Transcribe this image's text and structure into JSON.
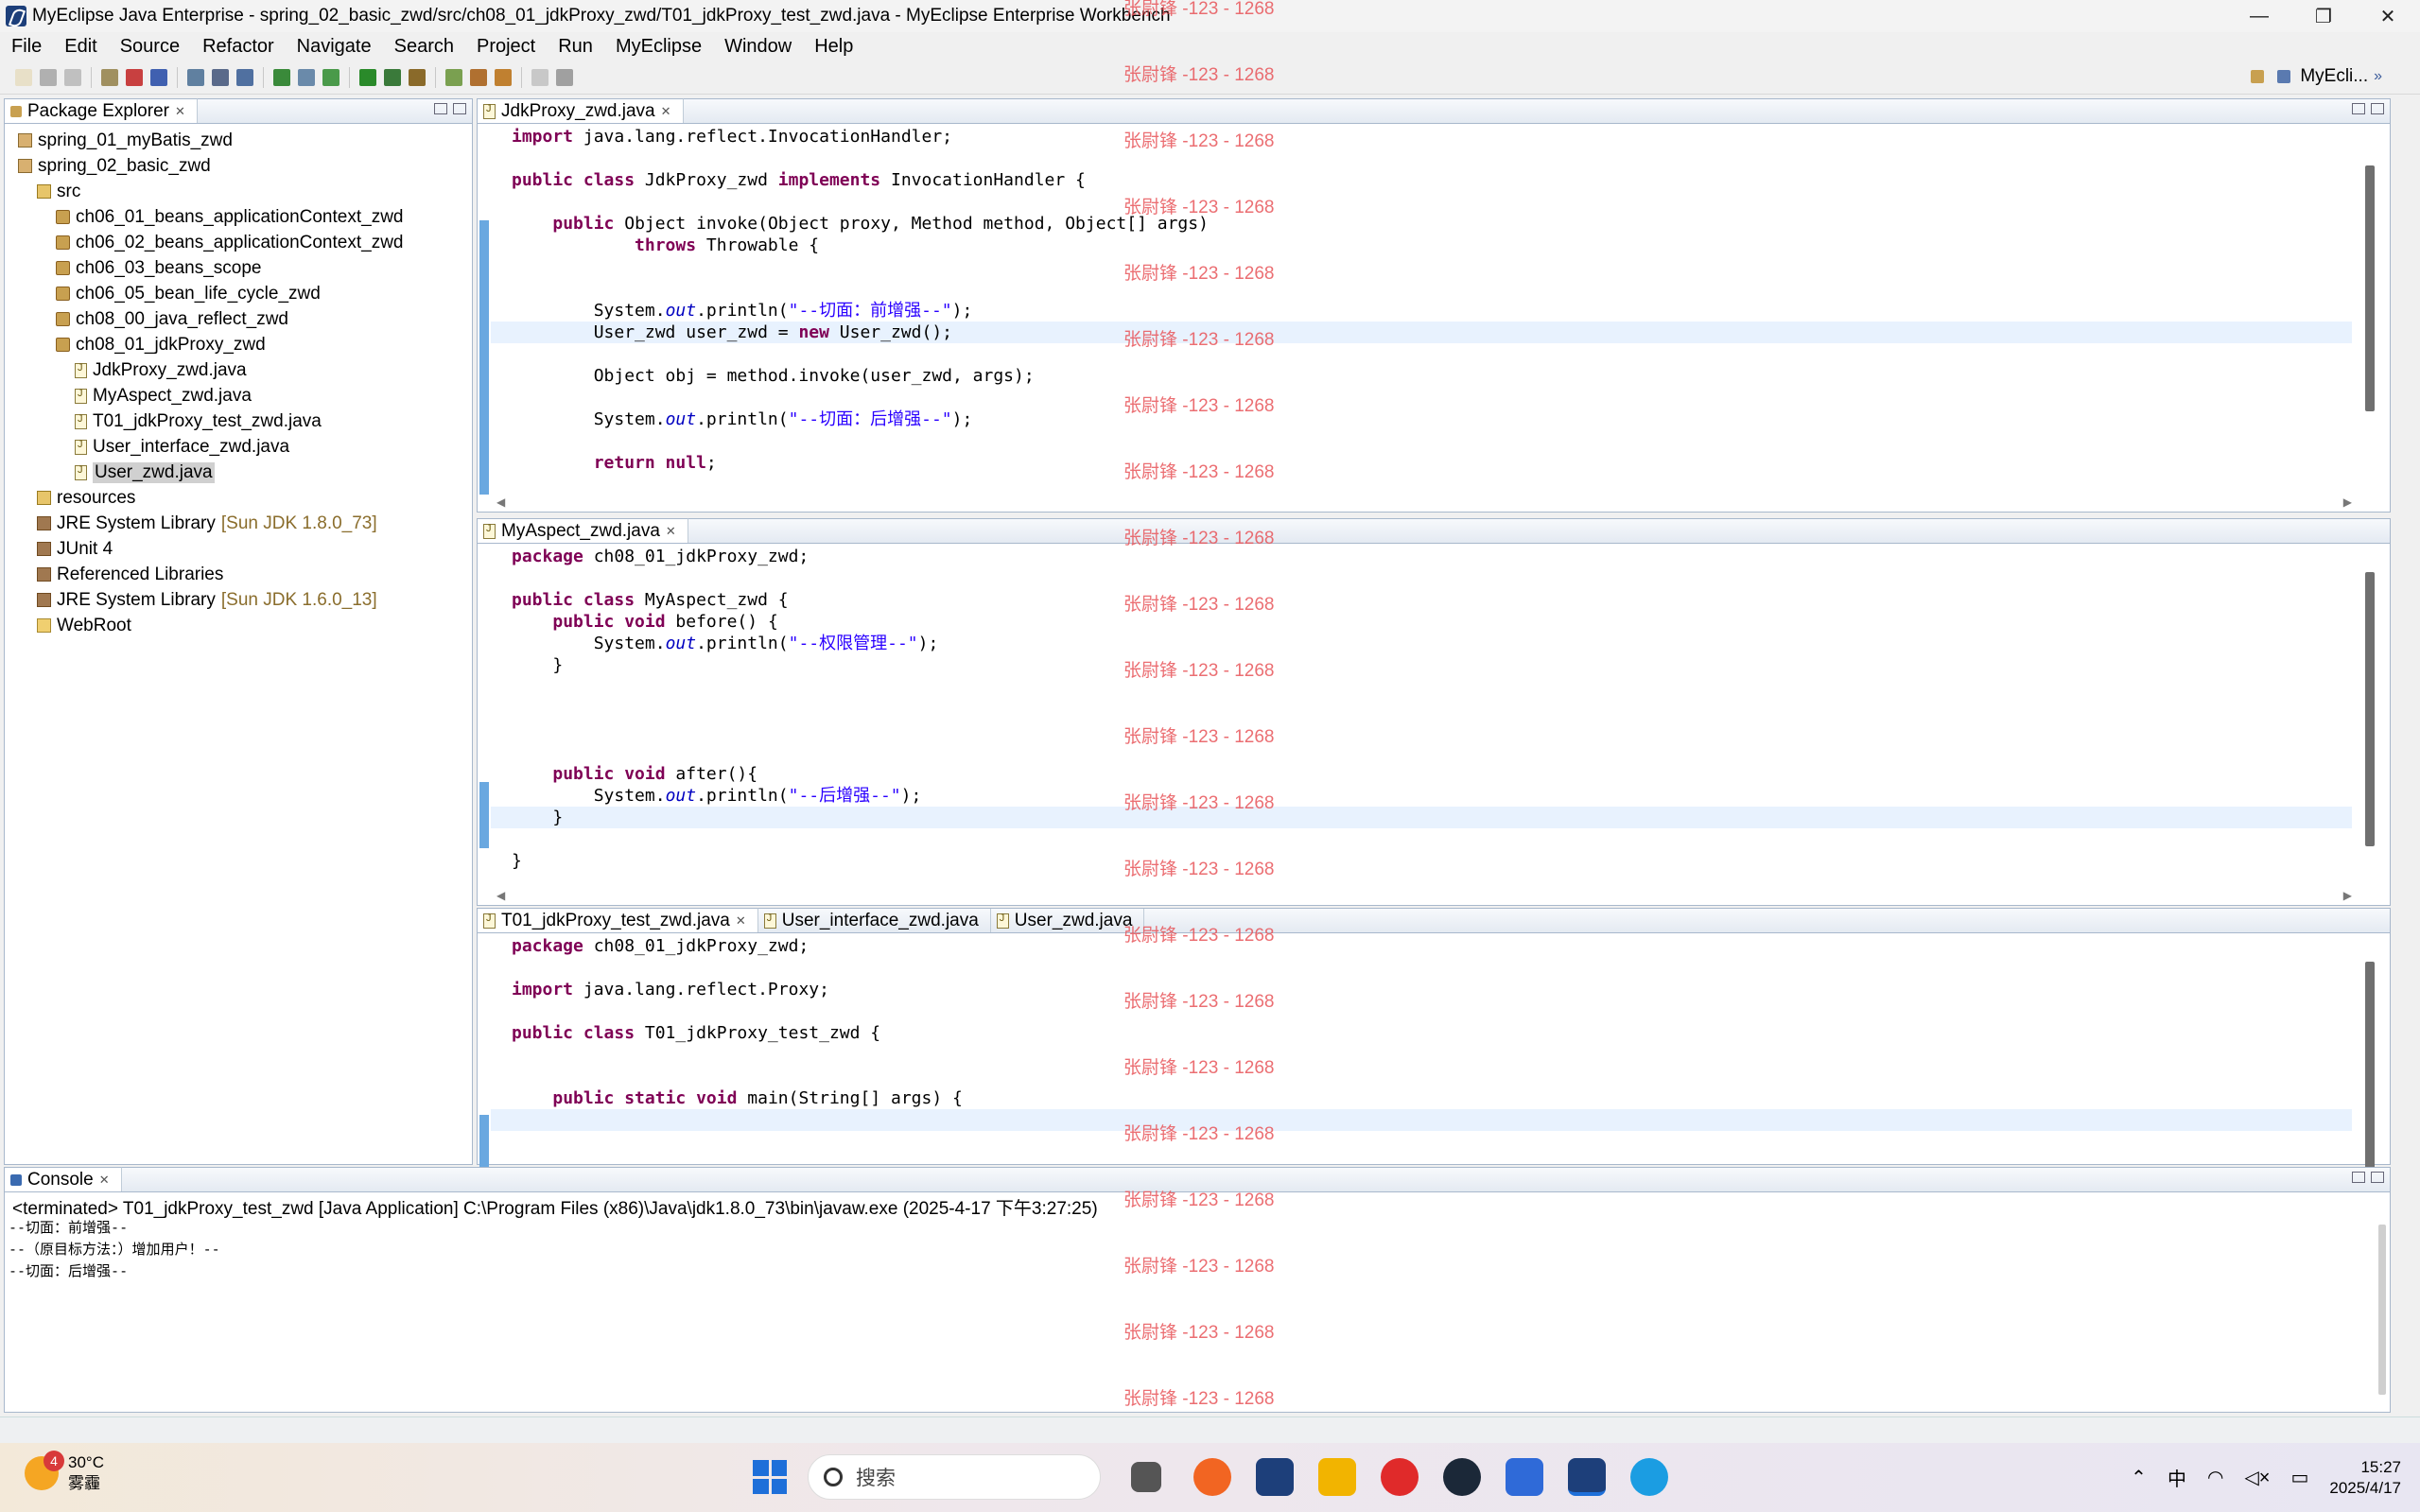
{
  "window": {
    "title": "MyEclipse Java Enterprise - spring_02_basic_zwd/src/ch08_01_jdkProxy_zwd/T01_jdkProxy_test_zwd.java - MyEclipse Enterprise Workbench",
    "minimize": "—",
    "restore": "❐",
    "close": "✕"
  },
  "menu": [
    "File",
    "Edit",
    "Source",
    "Refactor",
    "Navigate",
    "Search",
    "Project",
    "Run",
    "MyEclipse",
    "Window",
    "Help"
  ],
  "perspective": "MyEcli...",
  "package_explorer": {
    "title": "Package Explorer",
    "items": [
      {
        "label": "spring_01_myBatis_zwd",
        "icon": "project-icon",
        "indent": 0
      },
      {
        "label": "spring_02_basic_zwd",
        "icon": "project-icon",
        "indent": 0
      },
      {
        "label": "src",
        "icon": "source-folder-icon",
        "indent": 1
      },
      {
        "label": "ch06_01_beans_applicationContext_zwd",
        "icon": "package-icon",
        "indent": 2
      },
      {
        "label": "ch06_02_beans_applicationContext_zwd",
        "icon": "package-icon",
        "indent": 2
      },
      {
        "label": "ch06_03_beans_scope",
        "icon": "package-icon",
        "indent": 2
      },
      {
        "label": "ch06_05_bean_life_cycle_zwd",
        "icon": "package-icon",
        "indent": 2
      },
      {
        "label": "ch08_00_java_reflect_zwd",
        "icon": "package-icon",
        "indent": 2
      },
      {
        "label": "ch08_01_jdkProxy_zwd",
        "icon": "package-icon",
        "indent": 2
      },
      {
        "label": "JdkProxy_zwd.java",
        "icon": "java-file-icon",
        "indent": 3
      },
      {
        "label": "MyAspect_zwd.java",
        "icon": "java-file-icon",
        "indent": 3
      },
      {
        "label": "T01_jdkProxy_test_zwd.java",
        "icon": "java-file-icon",
        "indent": 3
      },
      {
        "label": "User_interface_zwd.java",
        "icon": "java-file-icon",
        "indent": 3
      },
      {
        "label": "User_zwd.java",
        "icon": "java-file-icon",
        "indent": 3,
        "selected": true
      },
      {
        "label": "resources",
        "icon": "source-folder-icon",
        "indent": 1
      },
      {
        "label": "JRE System Library",
        "suffix": "[Sun JDK 1.8.0_73]",
        "icon": "library-icon",
        "indent": 1
      },
      {
        "label": "JUnit 4",
        "icon": "library-icon",
        "indent": 1
      },
      {
        "label": "Referenced Libraries",
        "icon": "library-icon",
        "indent": 1
      },
      {
        "label": "JRE System Library",
        "suffix": "[Sun JDK 1.6.0_13]",
        "icon": "library-icon",
        "indent": 1
      },
      {
        "label": "WebRoot",
        "icon": "folder-icon",
        "indent": 1
      }
    ]
  },
  "editor1": {
    "tab": "JdkProxy_zwd.java",
    "lines": [
      "<span class='kw'>import</span> java.lang.reflect.InvocationHandler;",
      "",
      "<span class='kw'>public class</span> JdkProxy_zwd <span class='kw'>implements</span> InvocationHandler {",
      "",
      "    <span class='kw'>public</span> Object invoke(Object proxy, Method method, Object[] args)",
      "            <span class='kw'>throws</span> Throwable {",
      "",
      "",
      "        System.<span class='fld'>out</span>.println(<span class='str'>\"--切面：前增强--\"</span>);",
      "        User_zwd user_zwd = <span class='kw'>new</span> User_zwd();",
      "",
      "        Object obj = method.invoke(user_zwd, args);",
      "",
      "        System.<span class='fld'>out</span>.println(<span class='str'>\"--切面：后增强--\"</span>);",
      "",
      "        <span class='kw'>return null</span>;"
    ]
  },
  "editor2": {
    "tab": "MyAspect_zwd.java",
    "lines": [
      "<span class='kw'>package</span> ch08_01_jdkProxy_zwd;",
      "",
      "<span class='kw'>public class</span> MyAspect_zwd {",
      "    <span class='kw'>public void</span> before() {",
      "        System.<span class='fld'>out</span>.println(<span class='str'>\"--权限管理--\"</span>);",
      "    }",
      "",
      "",
      "",
      "",
      "    <span class='kw'>public void</span> after(){",
      "        System.<span class='fld'>out</span>.println(<span class='str'>\"--后增强--\"</span>);",
      "    }",
      "",
      "}"
    ]
  },
  "editor3": {
    "tabs": [
      "T01_jdkProxy_test_zwd.java",
      "User_interface_zwd.java",
      "User_zwd.java"
    ],
    "lines": [
      "<span class='kw'>package</span> ch08_01_jdkProxy_zwd;",
      "",
      "<span class='kw'>import</span> java.lang.reflect.Proxy;",
      "",
      "<span class='kw'>public class</span> T01_jdkProxy_test_zwd {",
      "",
      "",
      "    <span class='kw'>public static void</span> main(String[] args) {",
      ""
    ]
  },
  "console": {
    "title": "Console",
    "terminated": "<terminated> T01_jdkProxy_test_zwd [Java Application] C:\\Program Files (x86)\\Java\\jdk1.8.0_73\\bin\\javaw.exe (2025-4-17 下午3:27:25)",
    "output": [
      "--切面：前增强--",
      "--（原目标方法：）增加用户！--",
      "--切面：后增强--"
    ]
  },
  "watermark": "张尉锋 -123 - 1268",
  "taskbar": {
    "weather_badge": "4",
    "temperature": "30°C",
    "condition": "雾霾",
    "search_placeholder": "搜索",
    "ime": "中",
    "time": "15:27",
    "date": "2025/4/17"
  },
  "colors": {
    "keyword": "#7f0055",
    "string": "#2a00ff",
    "field": "#0000c0",
    "watermark": "#e8555a",
    "accent": "#1e6fd9"
  }
}
